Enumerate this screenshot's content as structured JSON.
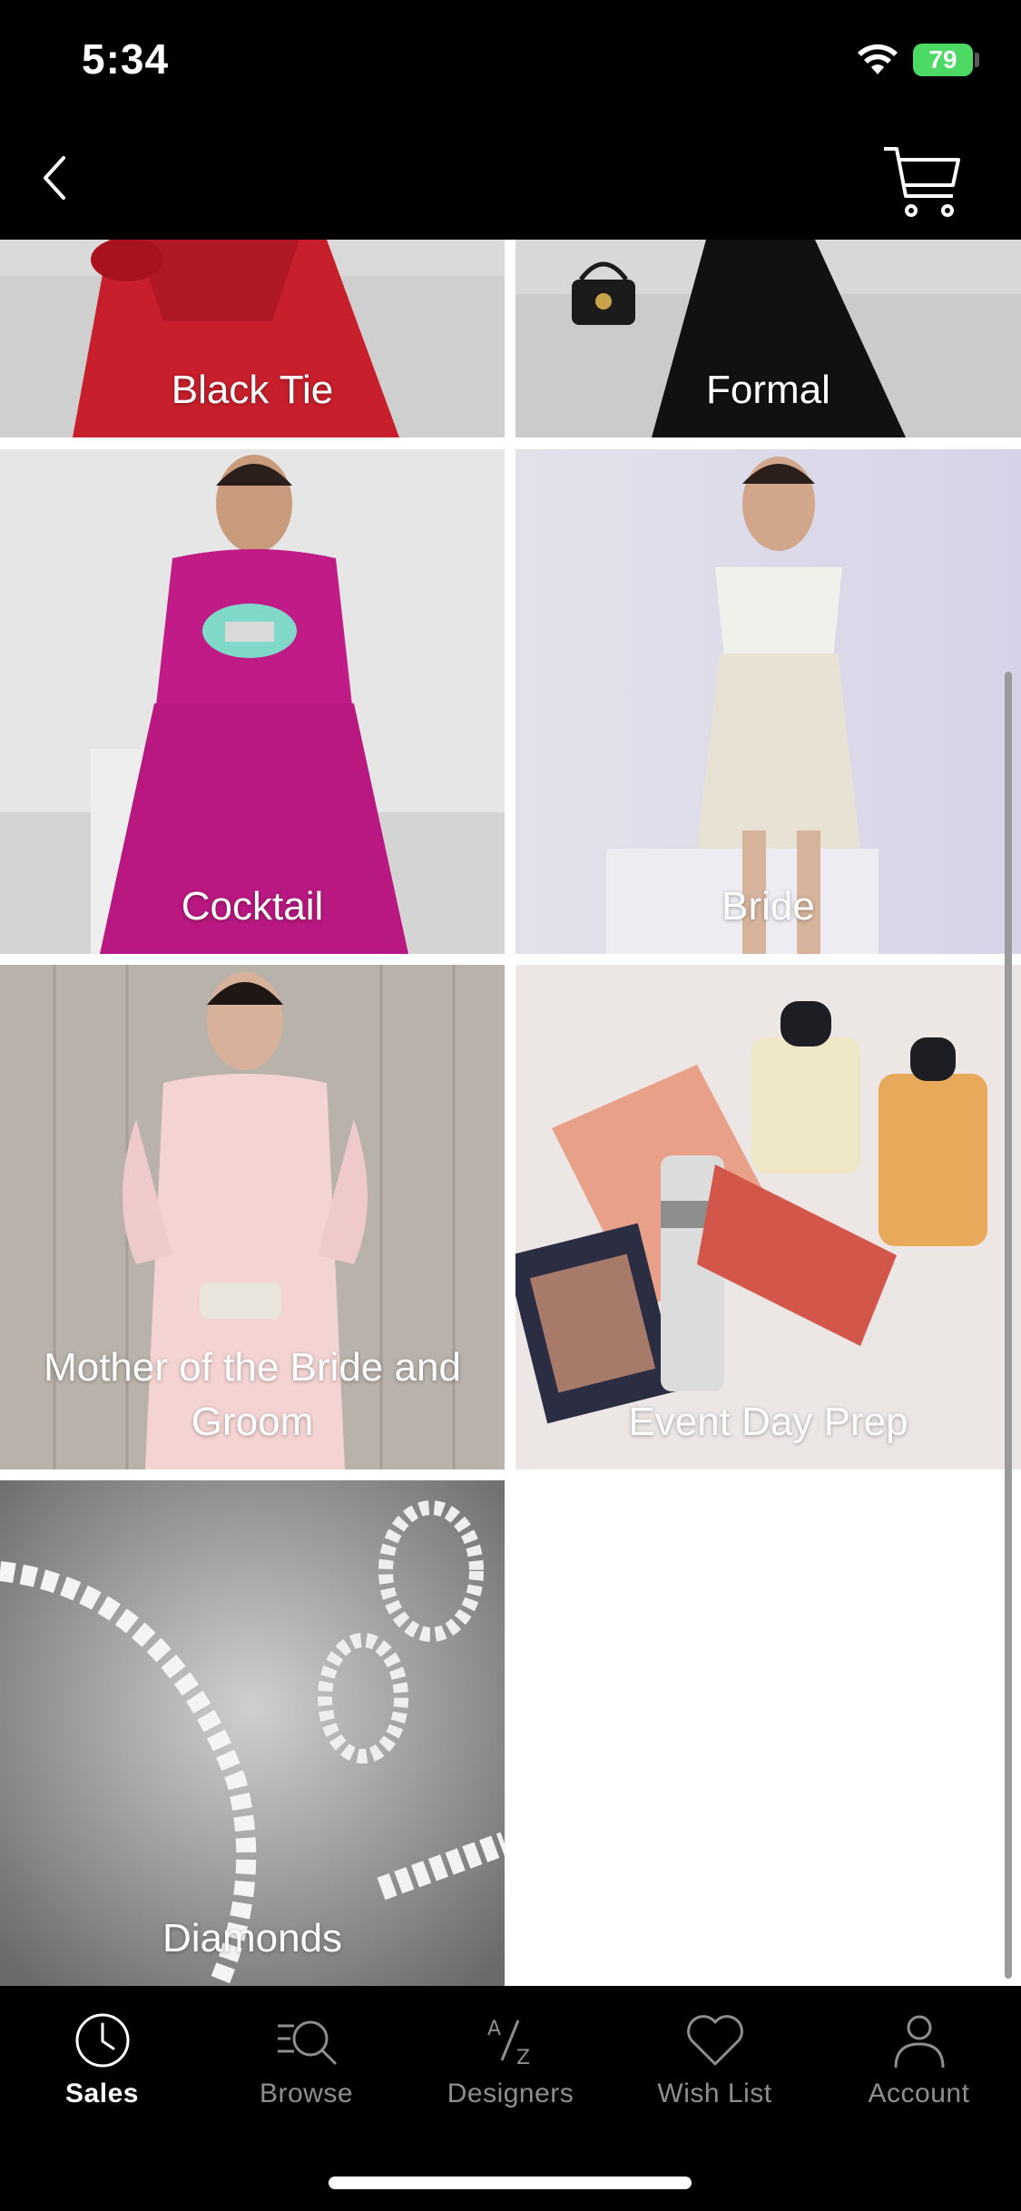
{
  "status_bar": {
    "time": "5:34",
    "battery": "79"
  },
  "nav": {
    "back_icon": "chevron-left-icon",
    "cart_icon": "cart-icon"
  },
  "categories": [
    {
      "label": "Black Tie"
    },
    {
      "label": "Formal"
    },
    {
      "label": "Cocktail"
    },
    {
      "label": "Bride"
    },
    {
      "label": "Mother of the Bride and Groom"
    },
    {
      "label": "Event Day Prep"
    },
    {
      "label": "Diamonds"
    }
  ],
  "tab_bar": {
    "tabs": [
      {
        "label": "Sales",
        "icon": "clock-icon",
        "active": true
      },
      {
        "label": "Browse",
        "icon": "search-icon",
        "active": false
      },
      {
        "label": "Designers",
        "icon": "a-z-icon",
        "active": false
      },
      {
        "label": "Wish List",
        "icon": "heart-icon",
        "active": false
      },
      {
        "label": "Account",
        "icon": "person-icon",
        "active": false
      }
    ]
  },
  "colors": {
    "background": "#000000",
    "active_tab": "#ffffff",
    "inactive_tab": "#8e8e8e"
  }
}
